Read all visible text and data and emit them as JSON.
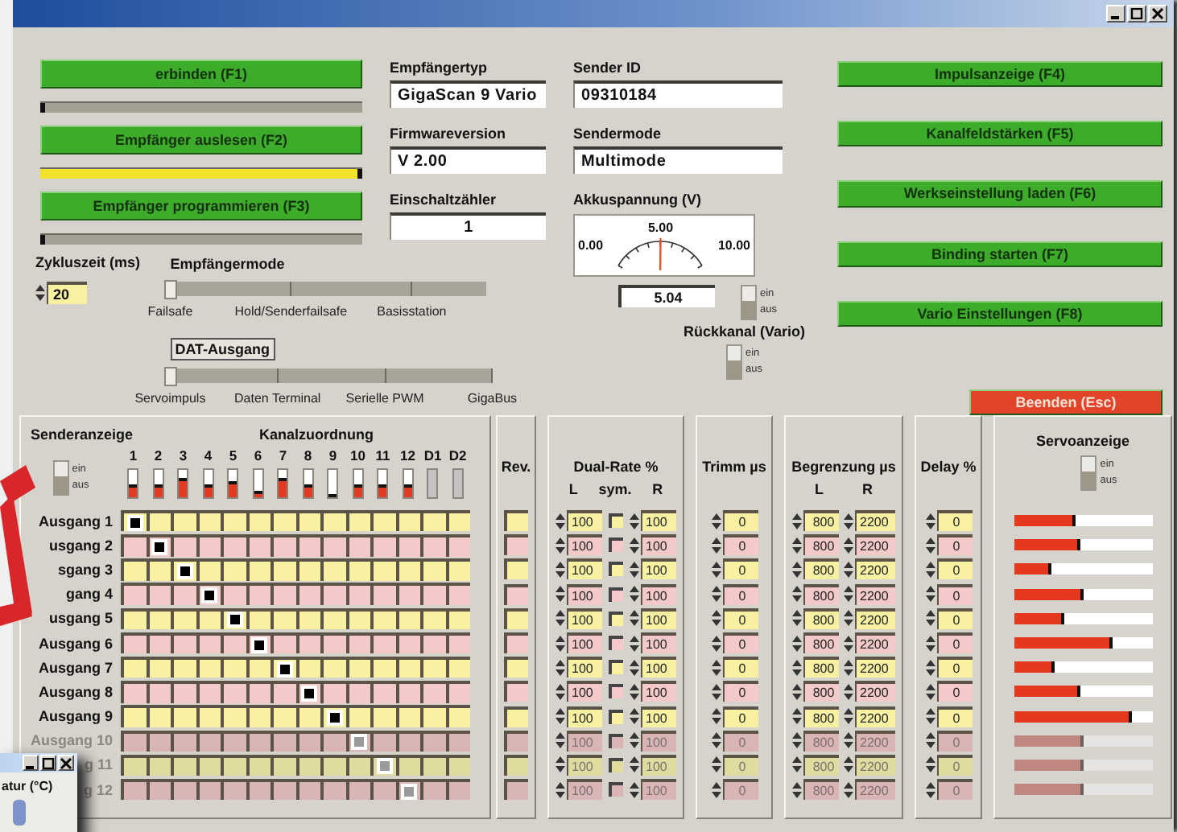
{
  "left_buttons": [
    {
      "label": "erbinden (F1)",
      "level": 0
    },
    {
      "label": "Empfänger auslesen (F2)",
      "level": 1
    },
    {
      "label": "Empfänger programmieren (F3)",
      "level": 0
    }
  ],
  "fields": [
    {
      "label": "Empfängertyp",
      "value": "GigaScan 9 Vario",
      "kind": "text"
    },
    {
      "label": "Firmwareversion",
      "value": "V 2.00",
      "kind": "text"
    },
    {
      "label": "Einschaltzähler",
      "value": "1",
      "kind": "counter"
    }
  ],
  "sender": [
    {
      "label": "Sender ID",
      "value": "09310184"
    },
    {
      "label": "Sendermode",
      "value": "Multimode"
    }
  ],
  "battery": {
    "label": "Akkuspannung (V)",
    "ticks": [
      "0.00",
      "5.00",
      "10.00"
    ],
    "reading": "5.04",
    "switch": {
      "on": false,
      "on_label": "ein",
      "off_label": "aus"
    }
  },
  "return_channel": {
    "label": "Rückkanal (Vario)",
    "switch": {
      "on": false,
      "on_label": "ein",
      "off_label": "aus"
    }
  },
  "cycle_time": {
    "label": "Zykluszeit (ms)",
    "value": "20"
  },
  "receiver_mode": {
    "label": "Empfängermode",
    "options": [
      {
        "label": "Failsafe",
        "selected": true
      },
      {
        "label": "Hold/Senderfailsafe",
        "selected": false
      },
      {
        "label": "Basisstation",
        "selected": false
      }
    ]
  },
  "dat_output": {
    "label": "DAT-Ausgang",
    "options": [
      {
        "label": "Servoimpuls",
        "selected": true
      },
      {
        "label": "Daten Terminal",
        "selected": false
      },
      {
        "label": "Serielle PWM",
        "selected": false
      },
      {
        "label": "GigaBus",
        "selected": false
      }
    ]
  },
  "right_buttons": [
    {
      "label": "Impulsanzeige (F4)",
      "kind": "action"
    },
    {
      "label": "Kanalfeldstärken (F5)",
      "kind": "action"
    },
    {
      "label": "Werkseinstellung laden (F6)",
      "kind": "action"
    },
    {
      "label": "Binding starten (F7)",
      "kind": "action"
    },
    {
      "label": "Vario Einstellungen (F8)",
      "kind": "action"
    },
    {
      "label": "Beenden (Esc)",
      "kind": "exit"
    }
  ],
  "transmitter_display": {
    "label": "Senderanzeige",
    "switch": {
      "on": false,
      "on_label": "ein",
      "off_label": "aus"
    }
  },
  "channel_map": {
    "title": "Kanalzuordnung",
    "channels": [
      {
        "label": "1",
        "level": 0.45,
        "disabled": false
      },
      {
        "label": "2",
        "level": 0.45,
        "disabled": false
      },
      {
        "label": "3",
        "level": 0.7,
        "disabled": false
      },
      {
        "label": "4",
        "level": 0.45,
        "disabled": false
      },
      {
        "label": "5",
        "level": 0.6,
        "disabled": false
      },
      {
        "label": "6",
        "level": 0.25,
        "disabled": false
      },
      {
        "label": "7",
        "level": 0.7,
        "disabled": false
      },
      {
        "label": "8",
        "level": 0.45,
        "disabled": false
      },
      {
        "label": "9",
        "level": 0.05,
        "disabled": false
      },
      {
        "label": "10",
        "level": 0.45,
        "disabled": false
      },
      {
        "label": "11",
        "level": 0.45,
        "disabled": false
      },
      {
        "label": "12",
        "level": 0.45,
        "disabled": false
      },
      {
        "label": "D1",
        "disabled": true
      },
      {
        "label": "D2",
        "disabled": true
      }
    ]
  },
  "columns": {
    "rev": "Rev.",
    "dual_rate": "Dual-Rate %",
    "dual_l": "L",
    "sym": "sym.",
    "dual_r": "R",
    "trim": "Trimm µs",
    "limit": "Begrenzung µs",
    "limit_l": "L",
    "limit_r": "R",
    "delay": "Delay %",
    "servo": "Servoanzeige"
  },
  "servo_switch": {
    "on": false,
    "on_label": "ein",
    "off_label": "aus"
  },
  "outputs": [
    {
      "label": "Ausgang 1",
      "disabled": false,
      "assignment": [
        true,
        false,
        false,
        false,
        false,
        false,
        false,
        false,
        false,
        false,
        false,
        false,
        false,
        false
      ],
      "dual_l": "100",
      "sym": false,
      "dual_r": "100",
      "trim": "0",
      "limit_l": "800",
      "limit_r": "2200",
      "delay": "0",
      "level": 0.45
    },
    {
      "label": "usgang 2",
      "disabled": false,
      "assignment": [
        false,
        true,
        false,
        false,
        false,
        false,
        false,
        false,
        false,
        false,
        false,
        false,
        false,
        false
      ],
      "dual_l": "100",
      "sym": false,
      "dual_r": "100",
      "trim": "0",
      "limit_l": "800",
      "limit_r": "2200",
      "delay": "0",
      "level": 0.48
    },
    {
      "label": "sgang 3",
      "disabled": false,
      "assignment": [
        false,
        false,
        true,
        false,
        false,
        false,
        false,
        false,
        false,
        false,
        false,
        false,
        false,
        false
      ],
      "dual_l": "100",
      "sym": false,
      "dual_r": "100",
      "trim": "0",
      "limit_l": "800",
      "limit_r": "2200",
      "delay": "0",
      "level": 0.27
    },
    {
      "label": "gang 4",
      "disabled": false,
      "assignment": [
        false,
        false,
        false,
        true,
        false,
        false,
        false,
        false,
        false,
        false,
        false,
        false,
        false,
        false
      ],
      "dual_l": "100",
      "sym": false,
      "dual_r": "100",
      "trim": "0",
      "limit_l": "800",
      "limit_r": "2200",
      "delay": "0",
      "level": 0.5
    },
    {
      "label": "usgang 5",
      "disabled": false,
      "assignment": [
        false,
        false,
        false,
        false,
        true,
        false,
        false,
        false,
        false,
        false,
        false,
        false,
        false,
        false
      ],
      "dual_l": "100",
      "sym": false,
      "dual_r": "100",
      "trim": "0",
      "limit_l": "800",
      "limit_r": "2200",
      "delay": "0",
      "level": 0.37
    },
    {
      "label": "Ausgang 6",
      "disabled": false,
      "assignment": [
        false,
        false,
        false,
        false,
        false,
        true,
        false,
        false,
        false,
        false,
        false,
        false,
        false,
        false
      ],
      "dual_l": "100",
      "sym": false,
      "dual_r": "100",
      "trim": "0",
      "limit_l": "800",
      "limit_r": "2200",
      "delay": "0",
      "level": 0.72
    },
    {
      "label": "Ausgang 7",
      "disabled": false,
      "assignment": [
        false,
        false,
        false,
        false,
        false,
        false,
        true,
        false,
        false,
        false,
        false,
        false,
        false,
        false
      ],
      "dual_l": "100",
      "sym": false,
      "dual_r": "100",
      "trim": "0",
      "limit_l": "800",
      "limit_r": "2200",
      "delay": "0",
      "level": 0.3
    },
    {
      "label": "Ausgang 8",
      "disabled": false,
      "assignment": [
        false,
        false,
        false,
        false,
        false,
        false,
        false,
        true,
        false,
        false,
        false,
        false,
        false,
        false
      ],
      "dual_l": "100",
      "sym": false,
      "dual_r": "100",
      "trim": "0",
      "limit_l": "800",
      "limit_r": "2200",
      "delay": "0",
      "level": 0.48
    },
    {
      "label": "Ausgang 9",
      "disabled": false,
      "assignment": [
        false,
        false,
        false,
        false,
        false,
        false,
        false,
        false,
        true,
        false,
        false,
        false,
        false,
        false
      ],
      "dual_l": "100",
      "sym": false,
      "dual_r": "100",
      "trim": "0",
      "limit_l": "800",
      "limit_r": "2200",
      "delay": "0",
      "level": 0.85
    },
    {
      "label": "Ausgang 10",
      "disabled": true,
      "assignment": [
        false,
        false,
        false,
        false,
        false,
        false,
        false,
        false,
        false,
        true,
        false,
        false,
        false,
        false
      ],
      "dual_l": "100",
      "sym": false,
      "dual_r": "100",
      "trim": "0",
      "limit_l": "800",
      "limit_r": "2200",
      "delay": "0",
      "level": 0.5
    },
    {
      "label": "g 11",
      "disabled": true,
      "assignment": [
        false,
        false,
        false,
        false,
        false,
        false,
        false,
        false,
        false,
        false,
        true,
        false,
        false,
        false
      ],
      "dual_l": "100",
      "sym": false,
      "dual_r": "100",
      "trim": "0",
      "limit_l": "800",
      "limit_r": "2200",
      "delay": "0",
      "level": 0.5
    },
    {
      "label": "g 12",
      "disabled": true,
      "assignment": [
        false,
        false,
        false,
        false,
        false,
        false,
        false,
        false,
        false,
        false,
        false,
        true,
        false,
        false
      ],
      "dual_l": "100",
      "sym": false,
      "dual_r": "100",
      "trim": "0",
      "limit_l": "800",
      "limit_r": "2200",
      "delay": "0",
      "level": 0.5
    }
  ],
  "mini_window": {
    "label": "atur (°C)"
  }
}
